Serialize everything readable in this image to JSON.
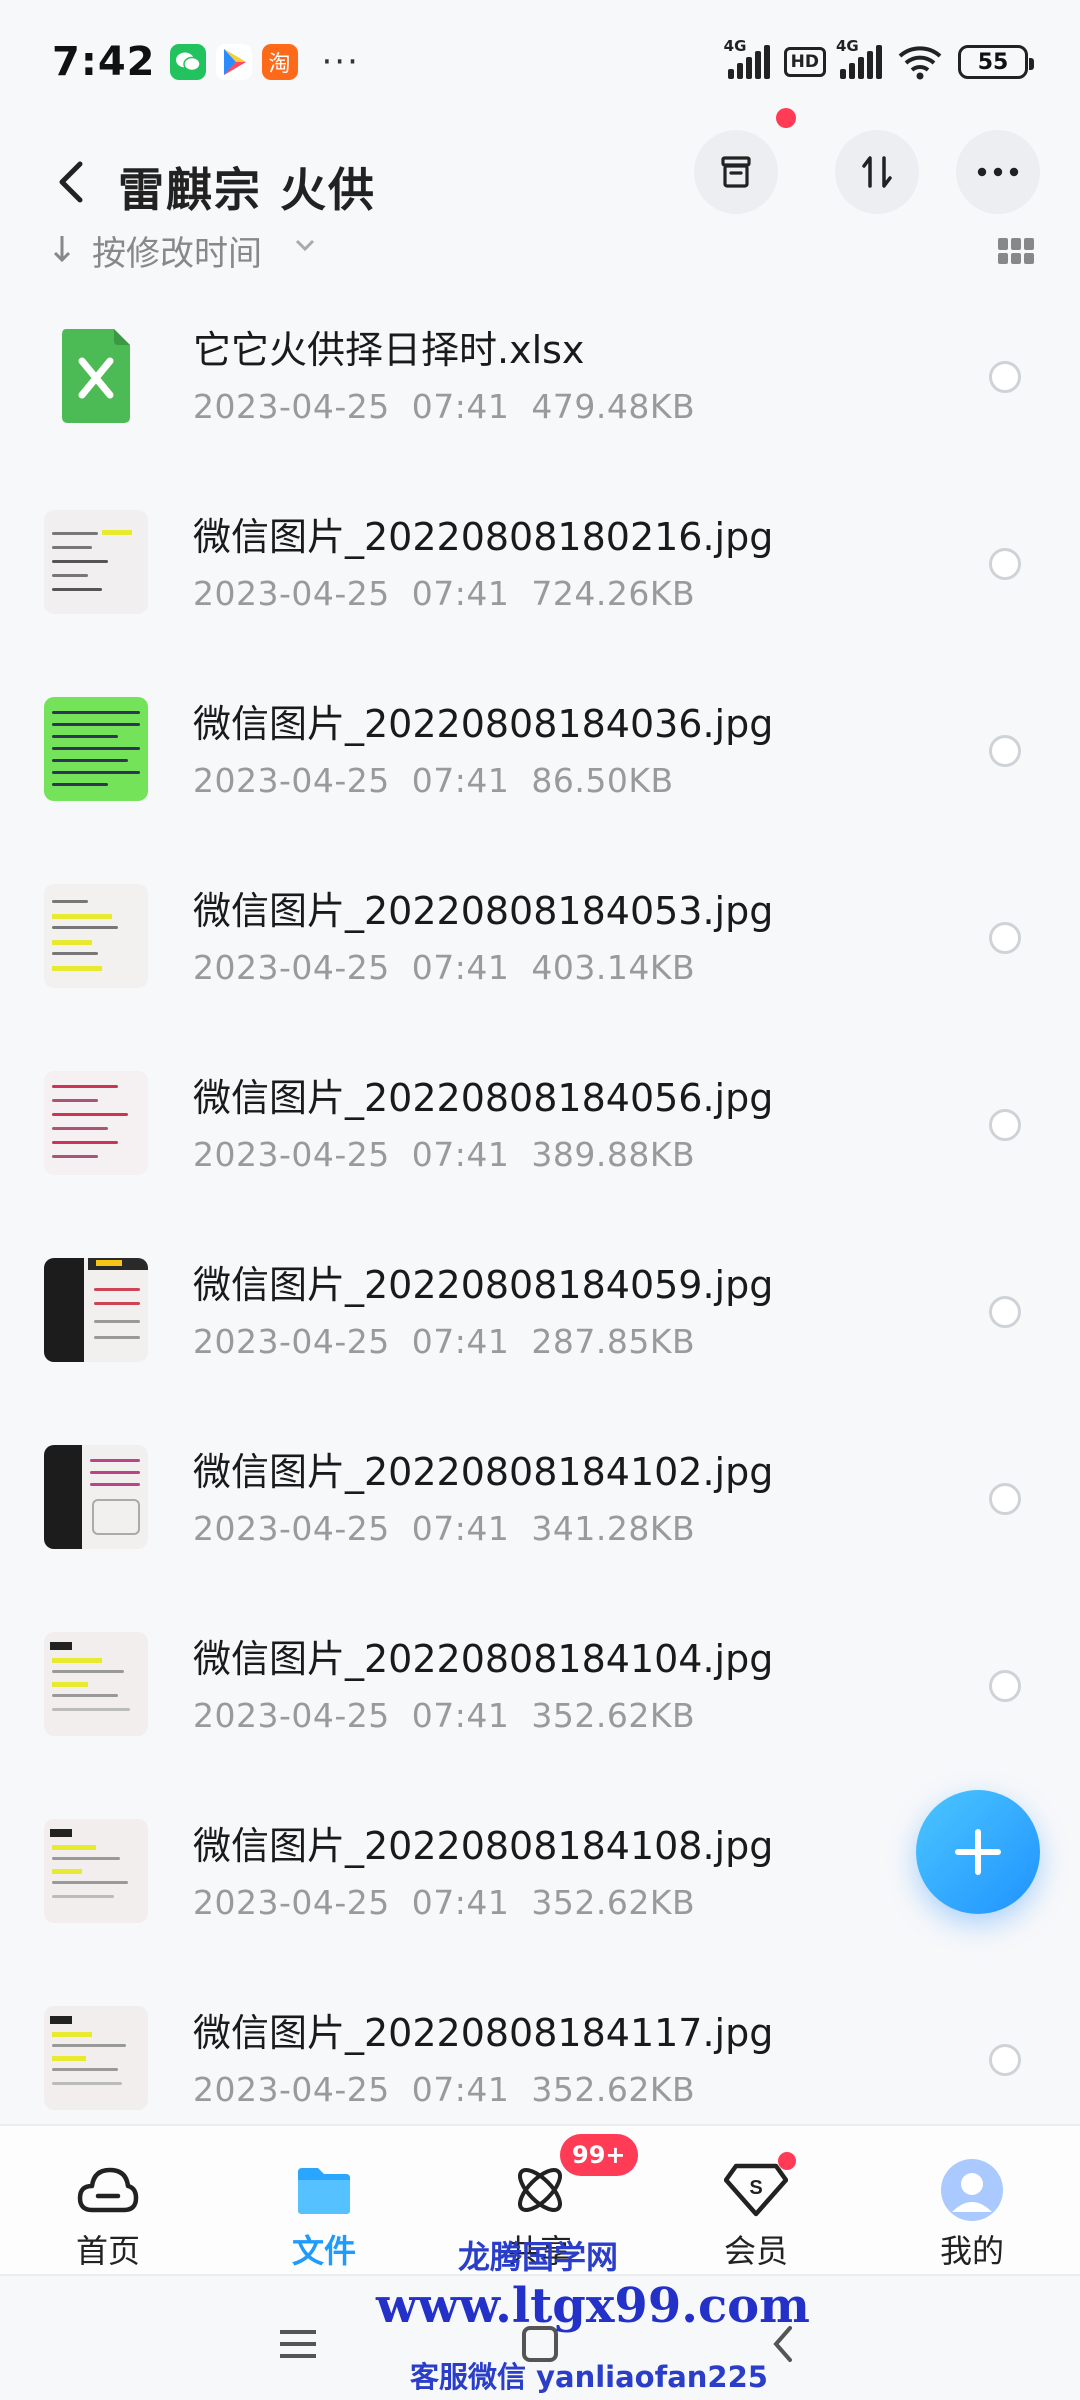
{
  "status_bar": {
    "time": "7:42",
    "signal1": "4G",
    "hd": "HD",
    "signal2": "4G",
    "battery": "55",
    "app_taobao": "淘",
    "more": "···"
  },
  "header": {
    "title": "雷麒宗 火供"
  },
  "sort": {
    "label": "按修改时间"
  },
  "files": [
    {
      "name": "它它火供择日择时.xlsx",
      "date": "2023-04-25",
      "time": "07:41",
      "size": "479.48KB"
    },
    {
      "name": "微信图片_20220808180216.jpg",
      "date": "2023-04-25",
      "time": "07:41",
      "size": "724.26KB"
    },
    {
      "name": "微信图片_20220808184036.jpg",
      "date": "2023-04-25",
      "time": "07:41",
      "size": "86.50KB"
    },
    {
      "name": "微信图片_20220808184053.jpg",
      "date": "2023-04-25",
      "time": "07:41",
      "size": "403.14KB"
    },
    {
      "name": "微信图片_20220808184056.jpg",
      "date": "2023-04-25",
      "time": "07:41",
      "size": "389.88KB"
    },
    {
      "name": "微信图片_20220808184059.jpg",
      "date": "2023-04-25",
      "time": "07:41",
      "size": "287.85KB"
    },
    {
      "name": "微信图片_20220808184102.jpg",
      "date": "2023-04-25",
      "time": "07:41",
      "size": "341.28KB"
    },
    {
      "name": "微信图片_20220808184104.jpg",
      "date": "2023-04-25",
      "time": "07:41",
      "size": "352.62KB"
    },
    {
      "name": "微信图片_20220808184108.jpg",
      "date": "2023-04-25",
      "time": "07:41",
      "size": "352.62KB"
    },
    {
      "name": "微信图片_20220808184117.jpg",
      "date": "2023-04-25",
      "time": "07:41",
      "size": "352.62KB"
    }
  ],
  "tabs": [
    {
      "label": "首页"
    },
    {
      "label": "文件"
    },
    {
      "label": "共享"
    },
    {
      "label": "会员"
    },
    {
      "label": "我的"
    }
  ],
  "badge": "99+",
  "watermark": {
    "line1": "龙腾国学网",
    "line2": "www.ltgx99.com",
    "line3": "客服微信 yanliaofan225"
  },
  "colors": {
    "accent": "#1e9bff",
    "badge": "#ff3b55",
    "xlsx": "#4dbb55"
  }
}
